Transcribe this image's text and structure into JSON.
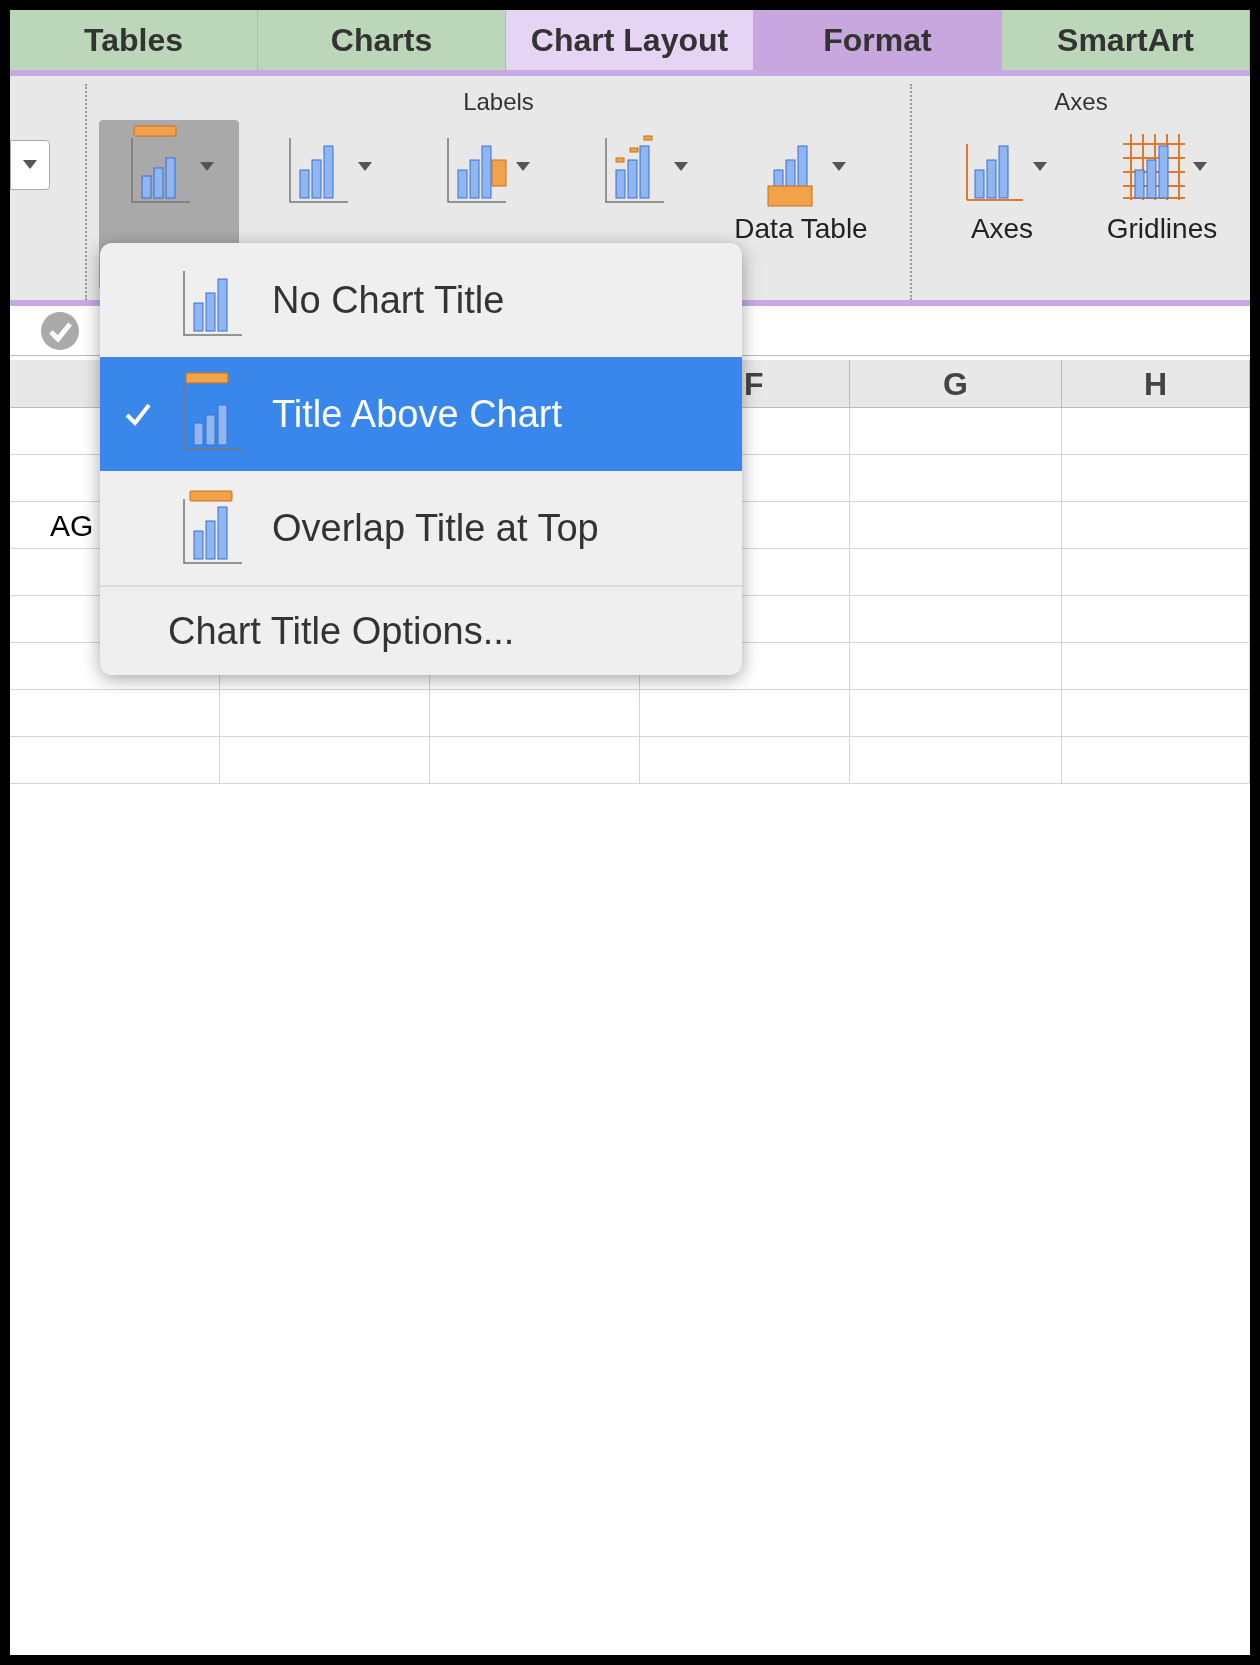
{
  "tabs": [
    {
      "label": "Tables",
      "selected": false,
      "kind": "green"
    },
    {
      "label": "Charts",
      "selected": false,
      "kind": "green"
    },
    {
      "label": "Chart Layout",
      "selected": true,
      "kind": "purple"
    },
    {
      "label": "Format",
      "selected": false,
      "kind": "purple"
    },
    {
      "label": "SmartArt",
      "selected": false,
      "kind": "green"
    }
  ],
  "ribbon": {
    "groups": [
      {
        "title": "Labels",
        "buttons": [
          {
            "kind": "chart_title",
            "selected": true
          },
          {
            "kind": "axis_titles",
            "selected": false
          },
          {
            "kind": "legend",
            "selected": false
          },
          {
            "kind": "data_labels",
            "selected": false
          },
          {
            "kind": "data_table",
            "selected": false,
            "label": "Data Table"
          }
        ]
      },
      {
        "title": "Axes",
        "buttons": [
          {
            "kind": "axes",
            "selected": false,
            "label": "Axes"
          },
          {
            "kind": "gridlines",
            "selected": false,
            "label": "Gridlines"
          }
        ]
      }
    ]
  },
  "sheet": {
    "column_headers": [
      "F",
      "G",
      "H"
    ],
    "visible_cell": "AG"
  },
  "menu": {
    "items": [
      {
        "kind": "none",
        "label": "No Chart Title",
        "selected": false
      },
      {
        "kind": "above",
        "label": "Title Above Chart",
        "selected": true
      },
      {
        "kind": "overlap",
        "label": "Overlap Title at Top",
        "selected": false
      },
      {
        "kind": "command",
        "label": "Chart Title Options..."
      }
    ]
  }
}
